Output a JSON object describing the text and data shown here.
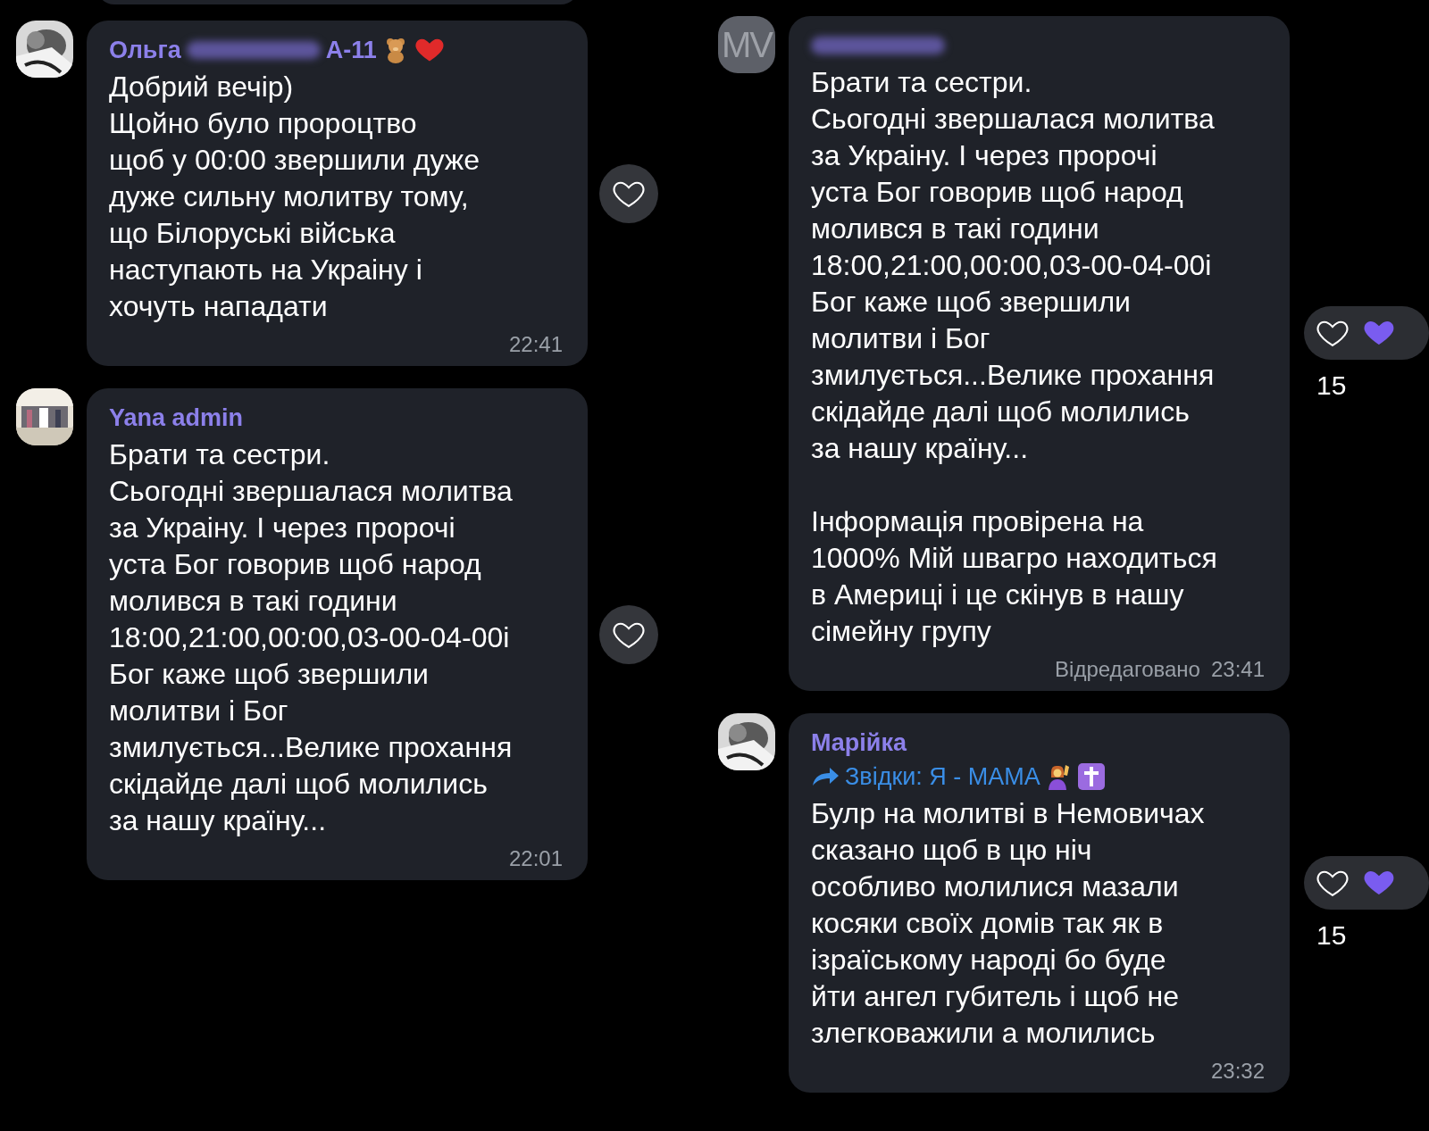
{
  "columns": [
    {
      "messages": [
        {
          "avatar": {
            "kind": "picture"
          },
          "sender": {
            "parts": [
              {
                "kind": "text",
                "text": "Ольга"
              },
              {
                "kind": "blurred"
              },
              {
                "kind": "text",
                "text": "А-11"
              },
              {
                "kind": "teddy"
              },
              {
                "kind": "heart"
              }
            ]
          },
          "paragraphs": [
            [
              "Добрий вечір)",
              "Щойно було пророцтво",
              "щоб у 00:00 звершили дуже",
              "дуже сильну молитву тому,",
              "що Білоруські війська",
              "наступають на Украіну і",
              "хочуть нападати"
            ]
          ],
          "time": "22:41",
          "reaction": {
            "kind": "button"
          }
        },
        {
          "avatar": {
            "kind": "picture"
          },
          "sender": {
            "parts": [
              {
                "kind": "text",
                "text": "Yana admin"
              }
            ]
          },
          "paragraphs": [
            [
              "Брати та сестри.",
              "Сьогодні звершалася молитва",
              "за Украіну. І через пророчі",
              "уста Бог говорив щоб народ",
              "молився в такі години",
              "18:00,21:00,00:00,03-00-04-00і",
              "Бог каже щоб звершили",
              "молитви і Бог",
              "змилується...Велике прохання",
              "скідайде далі щоб молились",
              "за нашу країну..."
            ]
          ],
          "time": "22:01",
          "reaction": {
            "kind": "button"
          }
        }
      ]
    },
    {
      "messages": [
        {
          "avatar": {
            "kind": "initials",
            "text": "MV"
          },
          "sender": {
            "parts": [
              {
                "kind": "blurred"
              }
            ]
          },
          "paragraphs": [
            [
              "Брати та сестри.",
              "Сьогодні звершалася молитва",
              "за Украіну. І через пророчі",
              "уста Бог говорив щоб народ",
              "молився в такі години",
              "18:00,21:00,00:00,03-00-04-00і",
              "Бог каже щоб звершили",
              "молитви і Бог",
              "змилується...Велике прохання",
              "скідайде далі щоб молились",
              "за нашу країну..."
            ],
            [
              "Інформація провірена на",
              "1000% Мій швагро находиться",
              "в Америці і це скінув в нашу",
              "сімейну групу"
            ]
          ],
          "edited": "Відредаговано",
          "time": "23:41",
          "reaction": {
            "kind": "count",
            "count": "15"
          }
        },
        {
          "avatar": {
            "kind": "picture"
          },
          "sender": {
            "parts": [
              {
                "kind": "text",
                "text": "Марійка"
              }
            ]
          },
          "forwarded": {
            "text": "Звідки: Я - МАМА"
          },
          "paragraphs": [
            [
              "Булр на молитві в Немовичах",
              "сказано щоб в цю ніч",
              "особливо молилися мазали",
              "косяки своїх домів так як в",
              "ізраїському народі бо буде",
              "йти ангел губитель і щоб не",
              "злегковажили а молились"
            ]
          ],
          "time": "23:32",
          "reaction": {
            "kind": "count",
            "count": "15"
          }
        }
      ]
    }
  ]
}
